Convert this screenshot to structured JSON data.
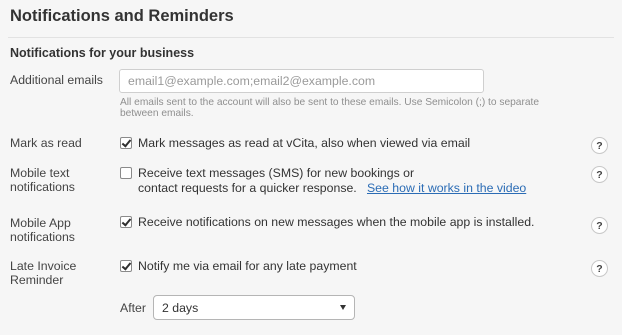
{
  "page_title": "Notifications and Reminders",
  "section_title": "Notifications for your business",
  "additional_emails": {
    "label": "Additional emails",
    "placeholder": "email1@example.com;email2@example.com",
    "value": "",
    "help_line1": "All emails sent to the account will also be sent to these emails. Use Semicolon (;) to separate",
    "help_line2": "between emails."
  },
  "mark_as_read": {
    "label": "Mark as read",
    "checked": true,
    "text": "Mark messages as read at vCita, also when viewed via email"
  },
  "mobile_text": {
    "label_line1": "Mobile text",
    "label_line2": "notifications",
    "checked": false,
    "text_line1": "Receive text messages (SMS) for new bookings or",
    "text_line2": "contact requests for a quicker response.",
    "link": "See how it works in the video"
  },
  "mobile_app": {
    "label_line1": "Mobile App",
    "label_line2": "notifications",
    "checked": true,
    "text": "Receive notifications on new messages when the mobile app is installed."
  },
  "late_invoice": {
    "label_line1": "Late Invoice",
    "label_line2": "Reminder",
    "checked": true,
    "text": "Notify me via email for any late payment"
  },
  "after": {
    "label": "After",
    "selected": "2 days"
  },
  "help_icon_glyph": "?",
  "colors": {
    "background": "#f6f6f6",
    "link": "#2b6cb5",
    "muted_text": "#8f8f8f"
  }
}
